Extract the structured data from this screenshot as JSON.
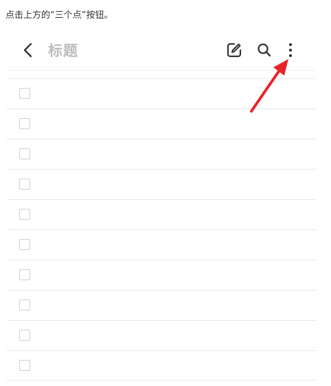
{
  "instruction": "点击上方的“三个点”按钮。",
  "toolbar": {
    "back_icon": "chevron-left-icon",
    "title": "标题",
    "edit_icon": "edit-icon",
    "search_icon": "search-icon",
    "more_icon": "more-vertical-icon"
  },
  "list": {
    "item_count": 10,
    "checked": [
      false,
      false,
      false,
      false,
      false,
      false,
      false,
      false,
      false,
      false
    ]
  },
  "colors": {
    "annotation_arrow": "#e8232a",
    "title_placeholder": "#bdbdbd",
    "divider": "#e8e8e8"
  }
}
